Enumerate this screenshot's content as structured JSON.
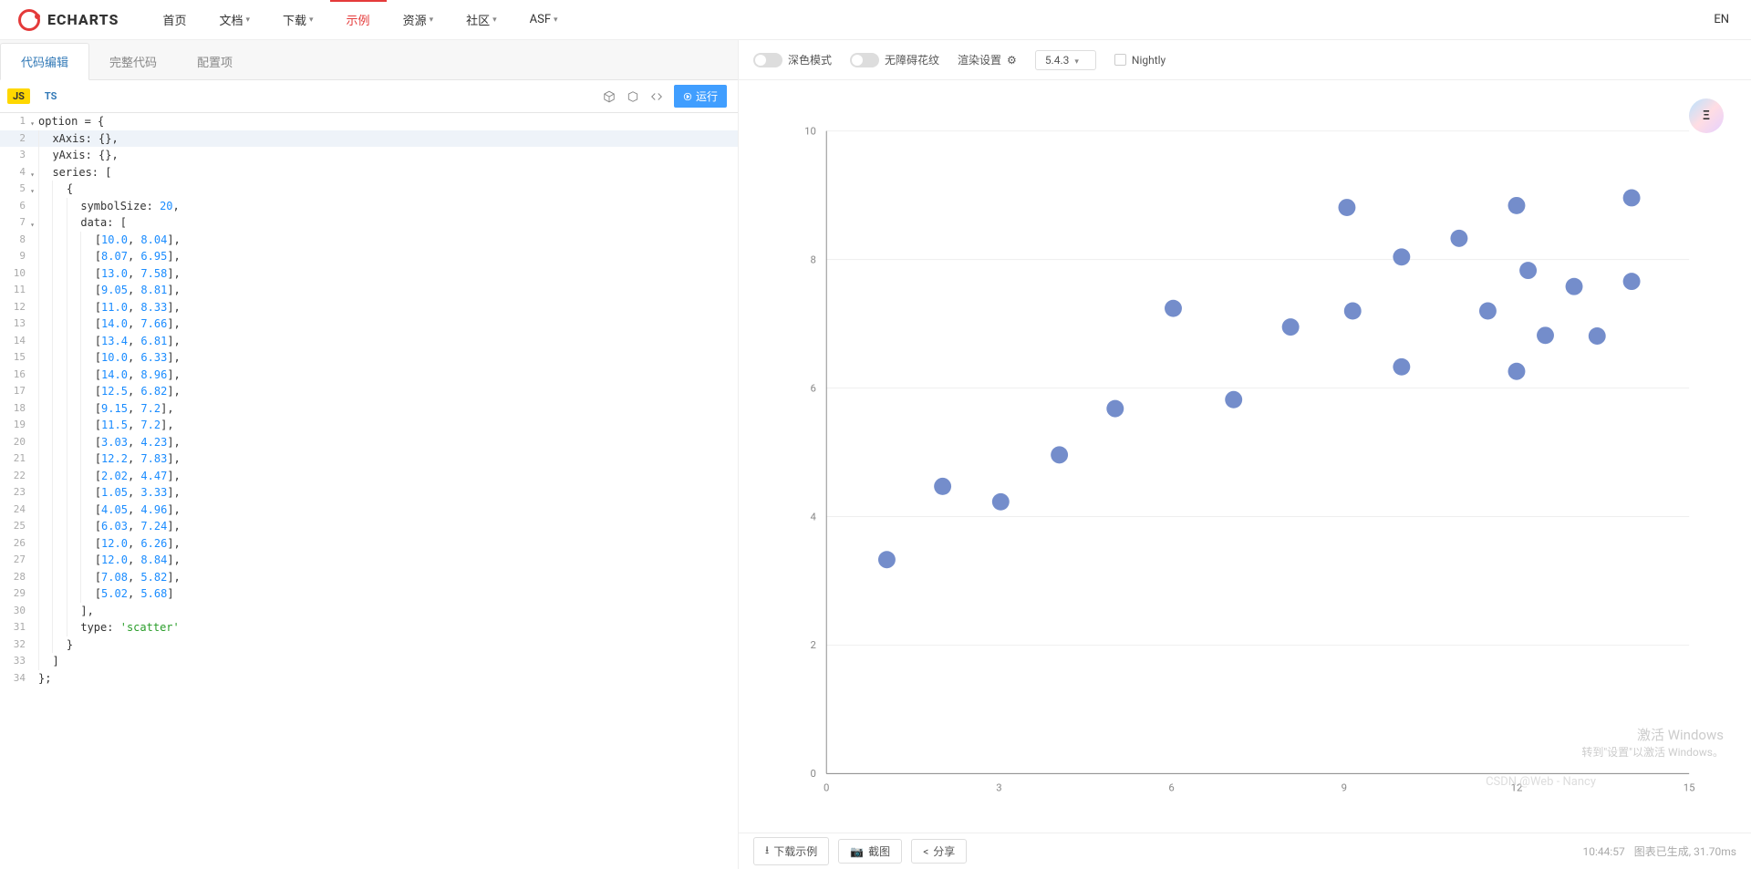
{
  "brand": "ECHARTS",
  "nav": {
    "items": [
      "首页",
      "文档",
      "下载",
      "示例",
      "资源",
      "社区",
      "ASF"
    ],
    "active_index": 3,
    "has_caret": [
      false,
      true,
      true,
      false,
      true,
      true,
      true
    ]
  },
  "lang_switch": "EN",
  "editor_tabs": {
    "items": [
      "代码编辑",
      "完整代码",
      "配置项"
    ],
    "active_index": 0
  },
  "lang_tabs": {
    "js": "JS",
    "ts": "TS"
  },
  "run_button": "运行",
  "options_bar": {
    "dark_mode": "深色模式",
    "pattern": "无障碍花纹",
    "render_settings": "渲染设置",
    "version": "5.4.3",
    "nightly": "Nightly"
  },
  "footer": {
    "download": "下载示例",
    "screenshot": "截图",
    "share": "分享",
    "time": "10:44:57",
    "render_stats": "图表已生成, 31.70ms"
  },
  "watermark": {
    "line1": "激活 Windows",
    "line2": "转到\"设置\"以激活 Windows。"
  },
  "csdn_watermark": "CSDN @Web - Nancy",
  "code_lines": [
    "option = {",
    "  xAxis: {},",
    "  yAxis: {},",
    "  series: [",
    "    {",
    "      symbolSize: 20,",
    "      data: [",
    "        [10.0, 8.04],",
    "        [8.07, 6.95],",
    "        [13.0, 7.58],",
    "        [9.05, 8.81],",
    "        [11.0, 8.33],",
    "        [14.0, 7.66],",
    "        [13.4, 6.81],",
    "        [10.0, 6.33],",
    "        [14.0, 8.96],",
    "        [12.5, 6.82],",
    "        [9.15, 7.2],",
    "        [11.5, 7.2],",
    "        [3.03, 4.23],",
    "        [12.2, 7.83],",
    "        [2.02, 4.47],",
    "        [1.05, 3.33],",
    "        [4.05, 4.96],",
    "        [6.03, 7.24],",
    "        [12.0, 6.26],",
    "        [12.0, 8.84],",
    "        [7.08, 5.82],",
    "        [5.02, 5.68]",
    "      ],",
    "      type: 'scatter'",
    "    }",
    "  ]",
    "};"
  ],
  "highlight_line_index": 1,
  "fold_lines": [
    0,
    3,
    4,
    6
  ],
  "chart_data": {
    "type": "scatter",
    "x": [
      10.0,
      8.07,
      13.0,
      9.05,
      11.0,
      14.0,
      13.4,
      10.0,
      14.0,
      12.5,
      9.15,
      11.5,
      3.03,
      12.2,
      2.02,
      1.05,
      4.05,
      6.03,
      12.0,
      12.0,
      7.08,
      5.02
    ],
    "y": [
      8.04,
      6.95,
      7.58,
      8.81,
      8.33,
      7.66,
      6.81,
      6.33,
      8.96,
      6.82,
      7.2,
      7.2,
      4.23,
      7.83,
      4.47,
      3.33,
      4.96,
      7.24,
      6.26,
      8.84,
      5.82,
      5.68
    ],
    "xlim": [
      0,
      15
    ],
    "ylim": [
      0,
      10
    ],
    "xticks": [
      0,
      3,
      6,
      9,
      12,
      15
    ],
    "yticks": [
      0,
      2,
      4,
      6,
      8,
      10
    ],
    "symbolSize": 20,
    "point_color": "#6d87c8",
    "title": "",
    "xlabel": "",
    "ylabel": ""
  }
}
